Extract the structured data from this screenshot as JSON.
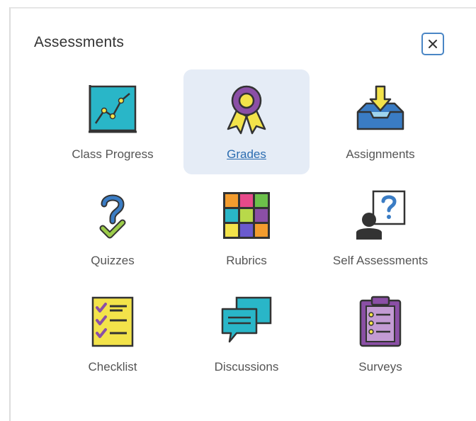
{
  "panel": {
    "title": "Assessments",
    "close_label": "Close"
  },
  "tools": [
    {
      "label": "Class Progress",
      "icon": "class-progress-icon",
      "selected": false
    },
    {
      "label": "Grades",
      "icon": "grades-ribbon-icon",
      "selected": true
    },
    {
      "label": "Assignments",
      "icon": "assignments-inbox-icon",
      "selected": false
    },
    {
      "label": "Quizzes",
      "icon": "quizzes-question-icon",
      "selected": false
    },
    {
      "label": "Rubrics",
      "icon": "rubrics-grid-icon",
      "selected": false
    },
    {
      "label": "Self Assessments",
      "icon": "self-assessments-icon",
      "selected": false
    },
    {
      "label": "Checklist",
      "icon": "checklist-icon",
      "selected": false
    },
    {
      "label": "Discussions",
      "icon": "discussions-icon",
      "selected": false
    },
    {
      "label": "Surveys",
      "icon": "surveys-clipboard-icon",
      "selected": false
    }
  ],
  "colors": {
    "selected_bg": "#e5ecf6",
    "link_blue": "#2b6cb0",
    "close_border": "#4a86c5"
  }
}
